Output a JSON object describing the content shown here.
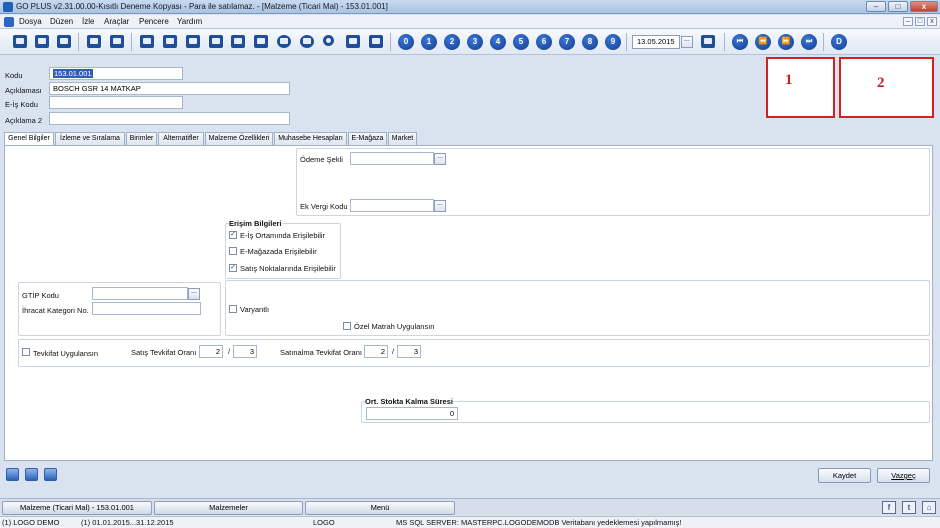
{
  "window": {
    "title": "GO PLUS v2.31.00.00-Kısıtlı Deneme Kopyası - Para ile satılamaz. - [Malzeme (Ticari Mal) - 153.01.001]",
    "min": "–",
    "max": "□",
    "close": "x"
  },
  "menu": {
    "items": [
      "Dosya",
      "Düzen",
      "İzle",
      "Araçlar",
      "Pencere",
      "Yardım"
    ]
  },
  "toolbar": {
    "numbers": [
      "0",
      "1",
      "2",
      "3",
      "4",
      "5",
      "6",
      "7",
      "8",
      "9"
    ],
    "date": "13.05.2015",
    "date_btn": "...",
    "d_label": "D"
  },
  "form": {
    "code_label": "Kodu",
    "code_value": "153.01.001",
    "desc_label": "Açıklaması",
    "desc_value": "BOSCH GSR 14 MATKAP",
    "eis_label": "E-İş Kodu",
    "eis_value": "",
    "desc2_label": "Açıklama 2",
    "desc2_value": ""
  },
  "annotations": {
    "box1": "1",
    "box2": "2"
  },
  "tabs": [
    "Genel Bilgiler",
    "İzleme ve Sıralama",
    "Birimler",
    "Alternatifler",
    "Malzeme Özellikleri",
    "Muhasebe Hesapları",
    "E-Mağaza",
    "Market"
  ],
  "general": {
    "payment_label": "Ödeme Şekli",
    "payment_value": "",
    "extra_tax_label": "Ek Vergi Kodu",
    "extra_tax_value": "",
    "access_title": "Erişim Bilgileri",
    "access": [
      {
        "label": "E-İş Ortamında Erişilebilir",
        "checked": true
      },
      {
        "label": "E-Mağazada Erişilebilir",
        "checked": false
      },
      {
        "label": "Satış Noktalarında Erişilebilir",
        "checked": true
      }
    ],
    "gtip_label": "GTİP Kodu",
    "gtip_value": "",
    "export_cat_label": "İhracat Kategori No.",
    "export_cat_value": "",
    "variant_label": "Varyantlı",
    "variant_checked": false,
    "special_tax_label": "Özel Matrah Uygulansın",
    "special_tax_checked": false,
    "withholding_label": "Tevkifat Uygulansın",
    "withholding_checked": false,
    "sales_rate_label": "Satış Tevkifat Oranı",
    "sales_rate_a": "2",
    "sales_rate_b": "3",
    "purchase_rate_label": "Satınalma Tevkifat Oranı",
    "purchase_rate_a": "2",
    "purchase_rate_b": "3",
    "slash": "/",
    "stock_title": "Ort. Stokta Kalma Süresi",
    "stock_value": "0"
  },
  "buttons": {
    "save": "Kaydet",
    "cancel": "Vazgeç"
  },
  "taskbar": {
    "tabs": [
      "Malzeme (Ticari Mal) - 153.01.001",
      "Malzemeler",
      "Menü"
    ],
    "social": [
      "f",
      "t",
      "⌂"
    ]
  },
  "status": {
    "company": "(1) LOGO DEMO",
    "period": "(1) 01.01.2015...31.12.2015",
    "user": "LOGO",
    "message": "MS SQL SERVER: MASTERPC.LOGODEMODB Veritabanı yedeklemesi yapılmamış!"
  },
  "colors": {
    "accent": "#1f4f9a",
    "annotation": "#d42020"
  }
}
